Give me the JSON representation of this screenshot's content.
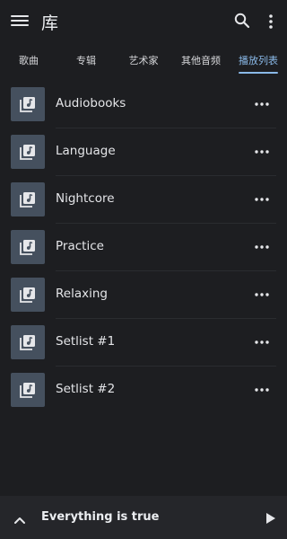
{
  "appbar": {
    "title": "库",
    "icons": {
      "menu": "menu-icon",
      "search": "search-icon",
      "more": "more-vertical-icon"
    }
  },
  "tabs": [
    {
      "label": "歌曲",
      "active": false
    },
    {
      "label": "专辑",
      "active": false
    },
    {
      "label": "艺术家",
      "active": false
    },
    {
      "label": "其他音频",
      "active": false
    },
    {
      "label": "播放列表",
      "active": true
    }
  ],
  "playlists": [
    {
      "name": "Audiobooks"
    },
    {
      "name": "Language"
    },
    {
      "name": "Nightcore"
    },
    {
      "name": "Practice"
    },
    {
      "name": "Relaxing"
    },
    {
      "name": "Setlist #1"
    },
    {
      "name": "Setlist #2"
    }
  ],
  "now_playing": {
    "title": "Everything is true",
    "icons": {
      "expand": "chevron-up-icon",
      "play": "play-icon"
    }
  },
  "colors": {
    "background": "#1d1e21",
    "accent": "#8ab9e8",
    "thumb": "#45505e",
    "now_playing_bar": "#25262a"
  }
}
